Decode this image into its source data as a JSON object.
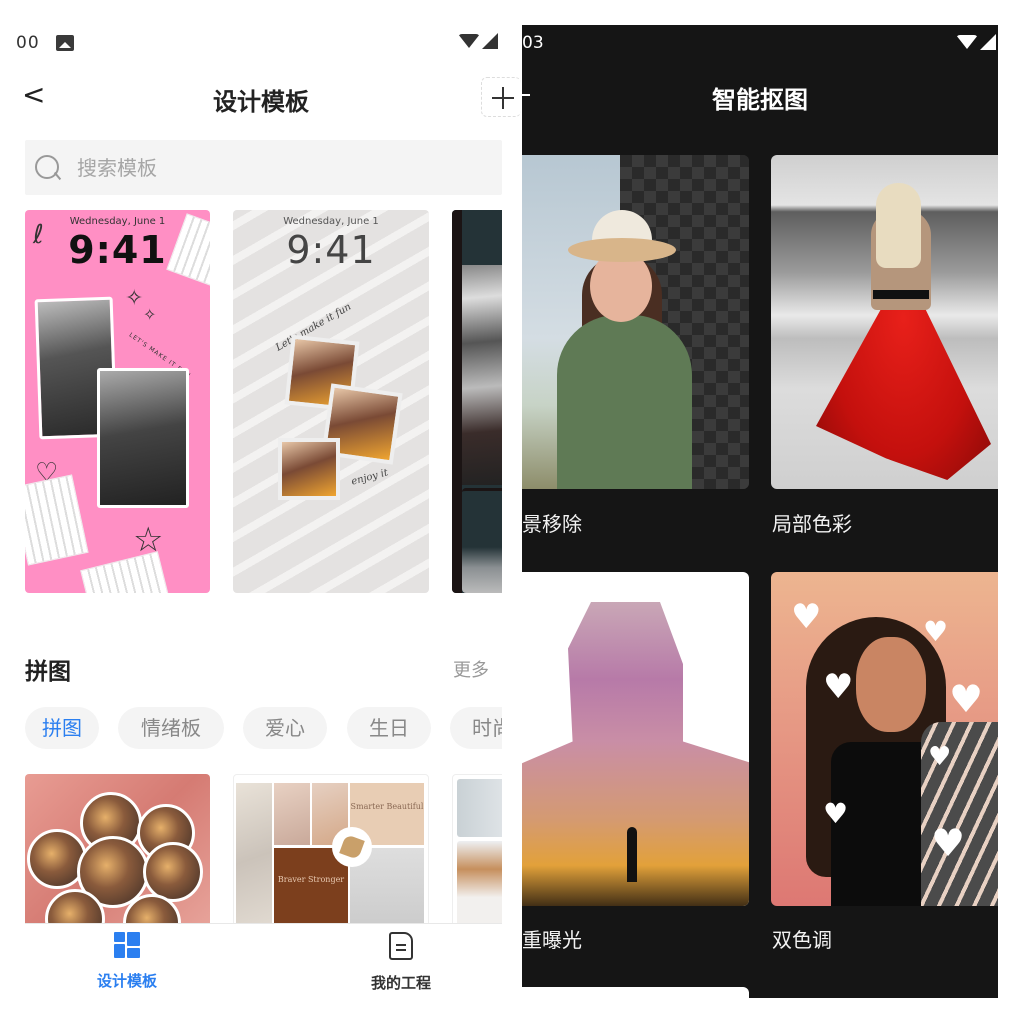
{
  "left_screen": {
    "status_bar": {
      "time_partial": "00",
      "icons": [
        "image-icon",
        "wifi-icon",
        "signal-icon"
      ]
    },
    "header": {
      "back_label": "<",
      "title": "设计模板",
      "add_button": "+"
    },
    "search": {
      "placeholder": "搜索模板",
      "value": ""
    },
    "templates": [
      {
        "type": "lockscreen",
        "date": "Wednesday, June 1",
        "time": "9:41",
        "text": "LET'S MAKE IT FUN",
        "bg": "#ff8fc4"
      },
      {
        "type": "lockscreen",
        "date": "Wednesday, June 1",
        "time": "9:41",
        "text": "Let's make it fun",
        "text2": "enjoy it",
        "bg": "#e4e2e1"
      },
      {
        "type": "photo",
        "bg": "#243337"
      }
    ],
    "section": {
      "title": "拼图",
      "more_label": "更多"
    },
    "chips": [
      {
        "label": "拼图",
        "active": true
      },
      {
        "label": "情绪板",
        "active": false
      },
      {
        "label": "爱心",
        "active": false
      },
      {
        "label": "生日",
        "active": false
      },
      {
        "label": "时尚",
        "active": false
      }
    ],
    "collages": [
      {
        "type": "circles"
      },
      {
        "type": "moodboard",
        "text_a": "Smarter Beautiful",
        "text_b": "Braver Stronger"
      },
      {
        "type": "photo"
      }
    ],
    "bottom_nav": [
      {
        "label": "设计模板",
        "icon": "template-grid-icon",
        "active": true
      },
      {
        "label": "我的工程",
        "icon": "document-icon",
        "active": false
      }
    ],
    "accent_color": "#2b7ff0"
  },
  "right_screen": {
    "status_bar": {
      "time_partial": "03"
    },
    "header": {
      "title": "智能抠图"
    },
    "features": [
      {
        "label": "景移除",
        "full_label": "背景移除"
      },
      {
        "label": "局部色彩"
      },
      {
        "label": "重曝光",
        "full_label": "双重曝光"
      },
      {
        "label": "双色调"
      }
    ],
    "background_color": "#151515"
  }
}
